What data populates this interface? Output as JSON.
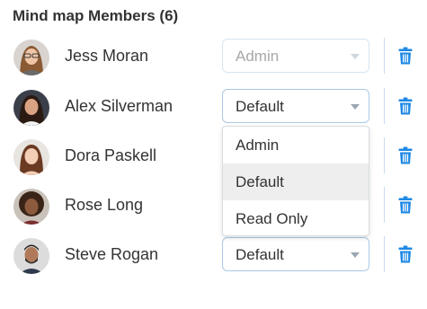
{
  "section": {
    "title": "Mind map Members (6)"
  },
  "members": [
    {
      "name": "Jess Moran",
      "role": "Admin",
      "disabled": true
    },
    {
      "name": "Alex Silverman",
      "role": "Default",
      "disabled": false
    },
    {
      "name": "Dora Paskell",
      "role": "",
      "disabled": false
    },
    {
      "name": "Rose Long",
      "role": "",
      "disabled": false
    },
    {
      "name": "Steve Rogan",
      "role": "Default",
      "disabled": false
    }
  ],
  "dropdown": {
    "options": [
      "Admin",
      "Default",
      "Read Only"
    ],
    "highlighted": "Default"
  },
  "icons": {
    "delete": "trash-icon",
    "expand": "caret-down-icon"
  },
  "colors": {
    "accent": "#1e88e5",
    "border": "#a9c9e6",
    "highlight": "#eeeeee"
  }
}
